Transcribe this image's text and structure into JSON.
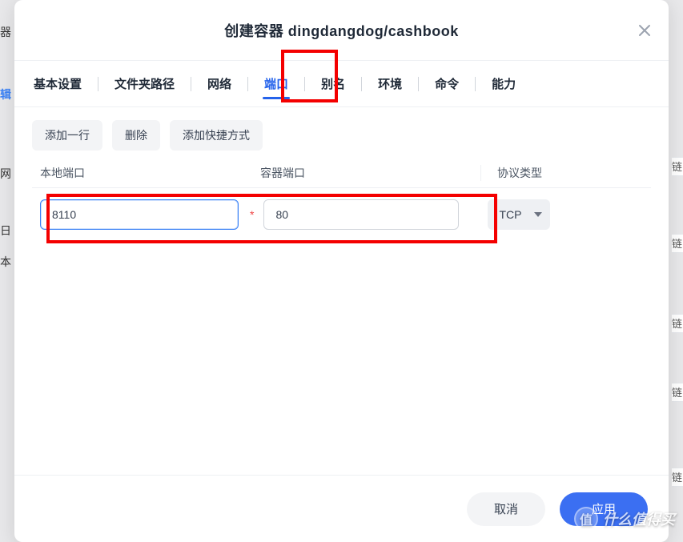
{
  "modal": {
    "title": "创建容器 dingdangdog/cashbook"
  },
  "tabs": [
    {
      "label": "基本设置"
    },
    {
      "label": "文件夹路径"
    },
    {
      "label": "网络"
    },
    {
      "label": "端口",
      "active": true
    },
    {
      "label": "别名"
    },
    {
      "label": "环境"
    },
    {
      "label": "命令"
    },
    {
      "label": "能力"
    }
  ],
  "actions": {
    "add_row": "添加一行",
    "delete": "删除",
    "add_shortcut": "添加快捷方式"
  },
  "columns": {
    "local_port": "本地端口",
    "container_port": "容器端口",
    "protocol": "协议类型"
  },
  "row": {
    "local_port": "8110",
    "container_port": "80",
    "protocol": "TCP"
  },
  "footer": {
    "cancel": "取消",
    "apply": "应用"
  },
  "background": {
    "frag1": "器",
    "link": "辑",
    "frag2": "网",
    "frag3": "日",
    "frag4": "本",
    "rows": "链"
  },
  "watermark": {
    "badge": "值",
    "text": "什么值得买"
  }
}
